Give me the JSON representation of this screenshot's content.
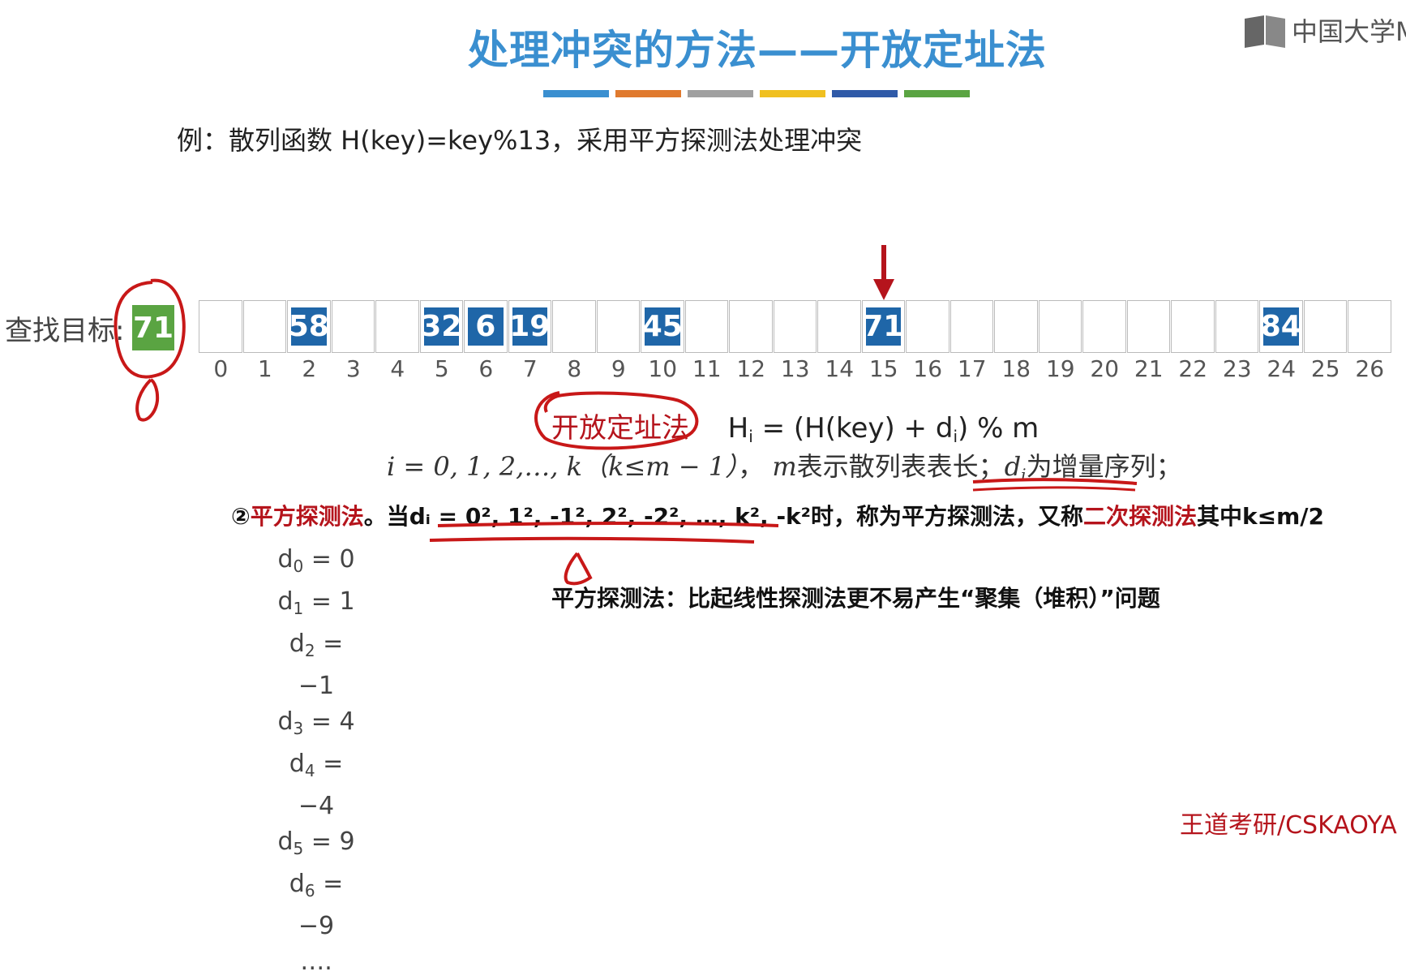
{
  "title": "处理冲突的方法——开放定址法",
  "color_strip": [
    "#3a8fd0",
    "#e07a2e",
    "#a0a0a0",
    "#f0c020",
    "#2f5aa8",
    "#5aa442"
  ],
  "logo": {
    "icon": "book-icon",
    "text": "中国大学M"
  },
  "example": "例：散列函数 H(key)=key%13，采用平方探测法处理冲突",
  "search": {
    "label": "查找目标:",
    "value": "71"
  },
  "table": {
    "cells": [
      "",
      "",
      "58",
      "",
      "",
      "32",
      "6",
      "19",
      "",
      "",
      "45",
      "",
      "",
      "",
      "",
      "71",
      "",
      "",
      "",
      "",
      "",
      "",
      "",
      "",
      "84",
      "",
      ""
    ],
    "indices": [
      "0",
      "1",
      "2",
      "3",
      "4",
      "5",
      "6",
      "7",
      "8",
      "9",
      "10",
      "11",
      "12",
      "13",
      "14",
      "15",
      "16",
      "17",
      "18",
      "19",
      "20",
      "21",
      "22",
      "23",
      "24",
      "25",
      "26"
    ],
    "arrow_index": 15
  },
  "formula": {
    "method": "开放定址法",
    "lhs": "H",
    "lhs_sub": "i",
    "mid": " = (H(key) + d",
    "mid_sub": "i",
    "rhs": ") % m"
  },
  "range_line": {
    "i_range": "i = 0, 1, 2,…, k（k≤m − 1）",
    "sep": "，",
    "m_var": "m",
    "m_desc": "表示散列表表长；",
    "d_var": "d",
    "d_sub": "i",
    "d_desc": "为增量序列；"
  },
  "rule": {
    "num": "②",
    "name": "平方探测法",
    "p1": "。当",
    "formula": "dᵢ = 0², 1², -1², 2², -2², …, k², -k²",
    "p2": "时，称为平方探测法，又称",
    "alt": "二次探测法",
    "p3": "其中k≤m/2"
  },
  "sequence": [
    {
      "sub": "0",
      "val": " = 0"
    },
    {
      "sub": "1",
      "val": " = 1"
    },
    {
      "sub": "2",
      "val": " = −1"
    },
    {
      "sub": "3",
      "val": " = 4"
    },
    {
      "sub": "4",
      "val": " = −4"
    },
    {
      "sub": "5",
      "val": " = 9"
    },
    {
      "sub": "6",
      "val": " = −9"
    }
  ],
  "sequence_var": "d",
  "sequence_more": "….",
  "note": "平方探测法：比起线性探测法更不易产生“聚集（堆积）”问题",
  "watermark": "王道考研/CSKAOYA"
}
